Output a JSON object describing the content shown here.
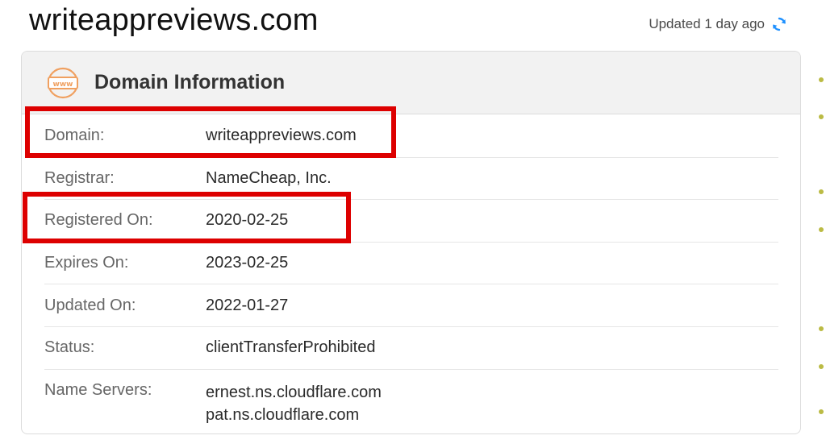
{
  "header": {
    "site_title": "writeappreviews.com",
    "updated_text": "Updated 1 day ago",
    "refresh_icon": "refresh-icon"
  },
  "card": {
    "title": "Domain Information",
    "icon": "www-icon",
    "icon_text": "www",
    "rows": [
      {
        "label": "Domain:",
        "value": "writeappreviews.com"
      },
      {
        "label": "Registrar:",
        "value": "NameCheap, Inc."
      },
      {
        "label": "Registered On:",
        "value": "2020-02-25"
      },
      {
        "label": "Expires On:",
        "value": "2023-02-25"
      },
      {
        "label": "Updated On:",
        "value": "2022-01-27"
      },
      {
        "label": "Status:",
        "value": "clientTransferProhibited"
      },
      {
        "label": "Name Servers:",
        "values": [
          "ernest.ns.cloudflare.com",
          "pat.ns.cloudflare.com"
        ]
      }
    ]
  },
  "colors": {
    "highlight": "#dd0000",
    "accent_icon": "#f0a060",
    "refresh": "#1e90ff"
  }
}
